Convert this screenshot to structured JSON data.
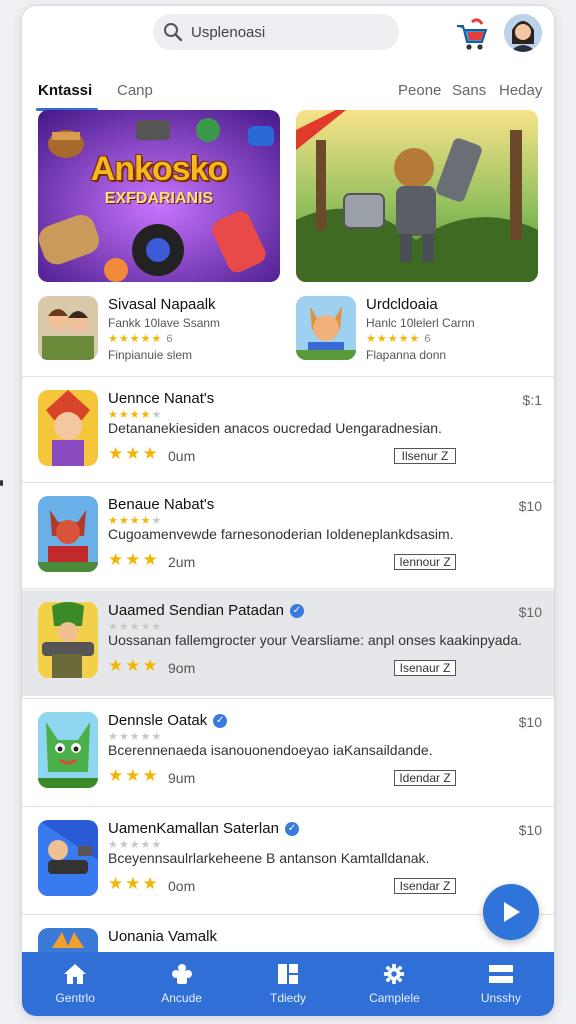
{
  "header": {
    "search_placeholder": "Usplenoasi"
  },
  "tabs": [
    {
      "label": "Kntassi",
      "active": true
    },
    {
      "label": "Canp"
    },
    {
      "label": "Peone"
    },
    {
      "label": "Sans"
    },
    {
      "label": "Heday"
    }
  ],
  "banners": {
    "left_title": "Ankosko",
    "left_subtitle": "EXFDARIANIS"
  },
  "featured": [
    {
      "title": "Sivasal Napaalk",
      "subtitle": "Fankk 10lave Ssanm",
      "rating_count": "6",
      "meta": "Finpianuie slem"
    },
    {
      "title": "Urdcldoaia",
      "subtitle": "Hanlc 10lelerl Carnn",
      "rating_count": "6",
      "meta": "Flapanna donn"
    }
  ],
  "apps": [
    {
      "title": "Uennce Nanat's",
      "verified": false,
      "stars": 4,
      "desc": "Detananekiesiden anacos oucredad Uengaradnesian.",
      "size": "0um",
      "price": "$:1",
      "button": "Ilsenur Z"
    },
    {
      "title": "Benaue Nabat's",
      "verified": false,
      "stars": 4,
      "desc": "Cugoamenvewde farnesonoderian Ioldeneplankdsasim.",
      "size": "2um",
      "price": "$10",
      "button": "Iennour Z"
    },
    {
      "title": "Uaamed Sendian Patadan",
      "verified": true,
      "stars": 0,
      "desc": "Uossanan fallemgrocter your Vearsliame: anpl onses kaakinpyada.",
      "size": "9om",
      "price": "$10",
      "button": "Isenaur Z"
    },
    {
      "title": "Dennsle Oatak",
      "verified": true,
      "stars": 0,
      "desc": "Bcerennenaeda isanouonendoeyao iaKansaildande.",
      "size": "9um",
      "price": "$10",
      "button": "Idendar Z"
    },
    {
      "title": "UamenKamallan Saterlan",
      "verified": true,
      "stars": 0,
      "desc": "Bceyennsaulrlarkeheene B antanson Kamtalldanak.",
      "size": "0om",
      "price": "$10",
      "button": "Isendar Z"
    },
    {
      "title": "Uonania Vamalk",
      "verified": false,
      "stars": 0,
      "desc": "",
      "size": "",
      "price": "",
      "button": ""
    }
  ],
  "bottom_nav": [
    {
      "label": "Gentrlo",
      "icon": "home-icon"
    },
    {
      "label": "Ancude",
      "icon": "puzzle-icon"
    },
    {
      "label": "Tdiedy",
      "icon": "grid-icon"
    },
    {
      "label": "Camplele",
      "icon": "gear-icon"
    },
    {
      "label": "Unsshy",
      "icon": "menu-icon"
    }
  ],
  "colors": {
    "accent": "#2f6fd6",
    "star": "#f2b705",
    "verified": "#3a7be0"
  }
}
